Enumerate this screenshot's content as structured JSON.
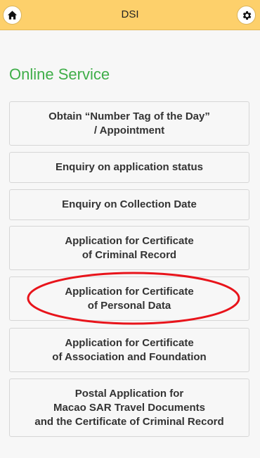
{
  "header": {
    "title": "DSI",
    "home_icon": "home-icon",
    "settings_icon": "gear-icon",
    "bar_color": "#fdd06b"
  },
  "section": {
    "title": "Online Service",
    "title_color": "#3fae49"
  },
  "menu": {
    "items": [
      {
        "label": "Obtain “Number Tag of the Day”\n/ Appointment"
      },
      {
        "label": "Enquiry on application status"
      },
      {
        "label": "Enquiry on Collection Date"
      },
      {
        "label": "Application for Certificate\nof Criminal Record"
      },
      {
        "label": "Application for Certificate\nof Personal Data"
      },
      {
        "label": "Application for Certificate\nof Association and Foundation"
      },
      {
        "label": "Postal Application for\nMacao SAR Travel Documents\nand the Certificate of Criminal Record"
      }
    ]
  },
  "annotation": {
    "highlight_color": "#e8141b"
  }
}
